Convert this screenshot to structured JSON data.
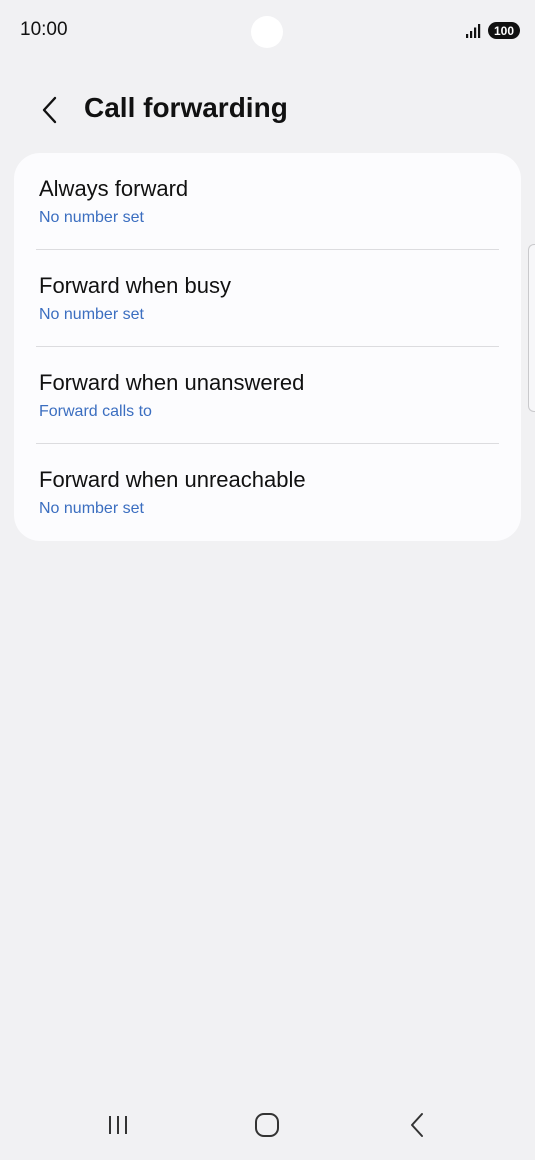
{
  "status_bar": {
    "time": "10:00",
    "battery": "100",
    "icons": [
      "signal-icon",
      "battery-icon"
    ]
  },
  "header": {
    "title": "Call forwarding",
    "back_icon": "chevron-left-icon"
  },
  "options": [
    {
      "title": "Always forward",
      "subtitle": "No number set"
    },
    {
      "title": "Forward when busy",
      "subtitle": "No number set"
    },
    {
      "title": "Forward when unanswered",
      "subtitle": "Forward calls to"
    },
    {
      "title": "Forward when unreachable",
      "subtitle": "No number set"
    }
  ],
  "nav_bar": {
    "icons": [
      "recent-apps-icon",
      "home-icon",
      "back-icon"
    ]
  },
  "colors": {
    "background": "#f1f1f3",
    "card": "#fcfcfe",
    "subtitle": "#3b6ec0"
  }
}
